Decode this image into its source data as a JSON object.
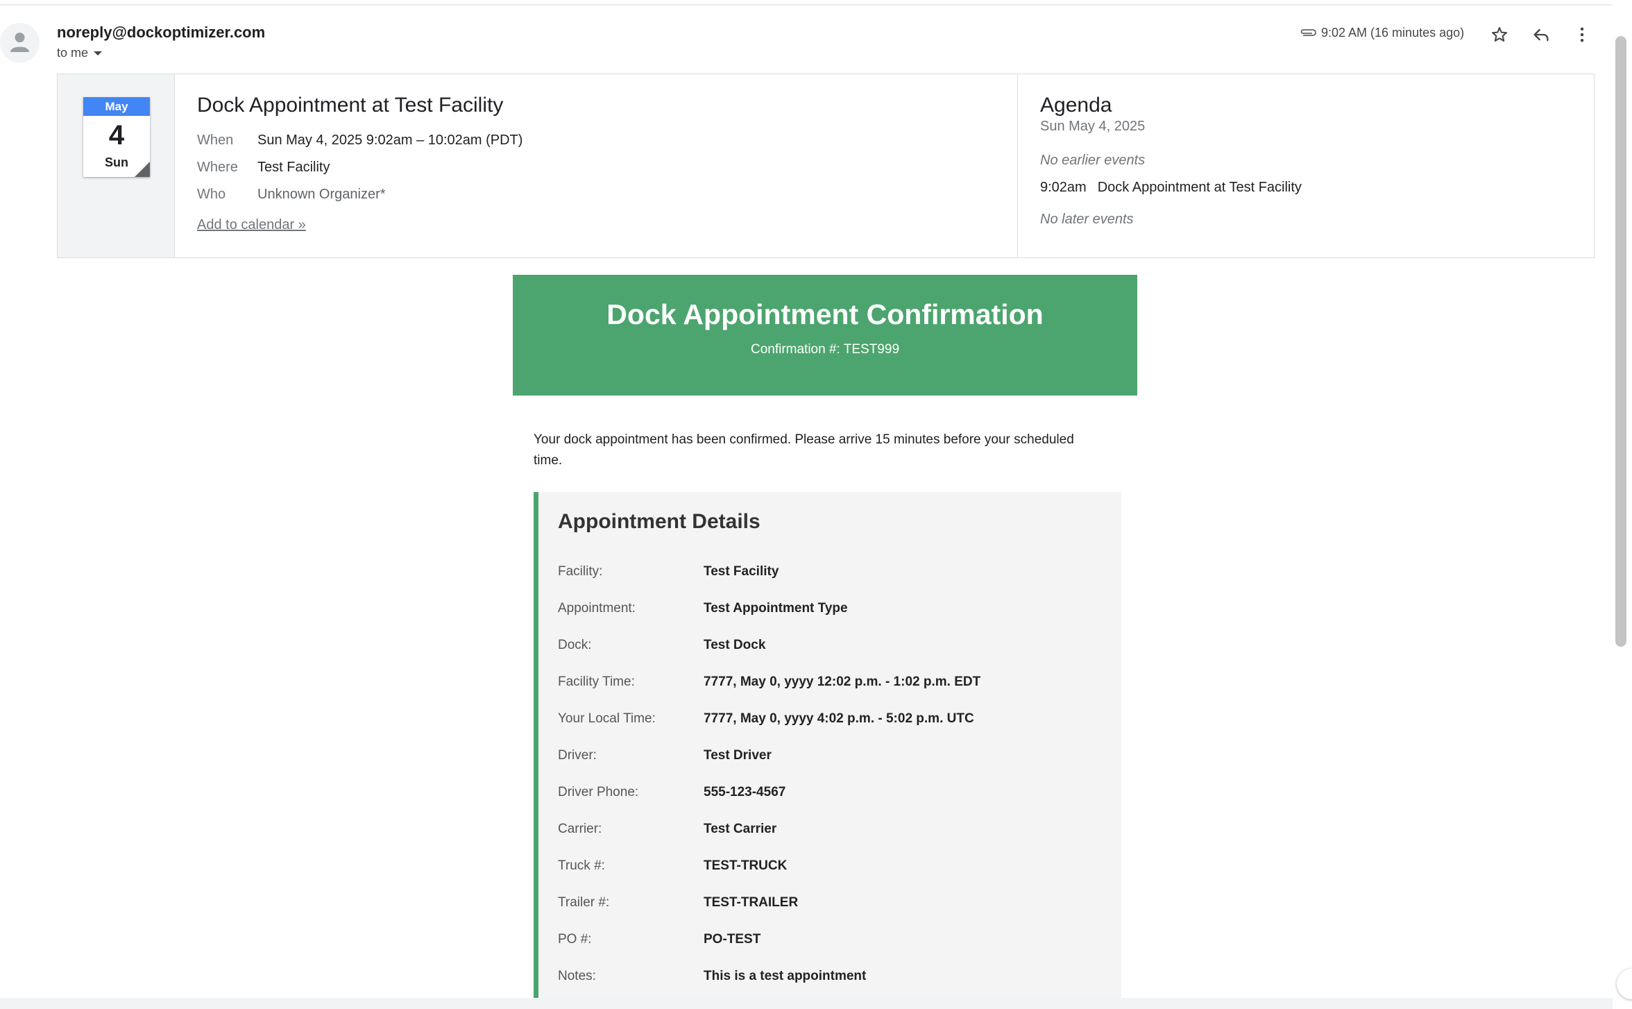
{
  "header": {
    "sender": "noreply@dockoptimizer.com",
    "recipient": "to me",
    "time": "9:02 AM (16 minutes ago)",
    "icons": [
      "attachment-icon",
      "star-icon",
      "reply-icon",
      "more-vert-icon"
    ]
  },
  "calendar": {
    "month": "May",
    "day": "4",
    "weekday": "Sun",
    "title": "Dock Appointment at Test Facility",
    "when_label": "When",
    "when_value": "Sun May 4, 2025 9:02am – 10:02am (PDT)",
    "where_label": "Where",
    "where_value": "Test Facility",
    "who_label": "Who",
    "who_value": "Unknown Organizer*",
    "add_link": "Add to calendar »",
    "agenda_title": "Agenda",
    "agenda_date": "Sun May 4, 2025",
    "no_earlier": "No earlier events",
    "event_time": "9:02am",
    "event_title": "Dock Appointment at Test Facility",
    "no_later": "No later events"
  },
  "email": {
    "banner_title": "Dock Appointment Confirmation",
    "confirmation": "Confirmation #: TEST999",
    "intro": "Your dock appointment has been confirmed. Please arrive 15 minutes before your scheduled time.",
    "details_heading": "Appointment Details",
    "details": [
      {
        "label": "Facility:",
        "value": "Test Facility"
      },
      {
        "label": "Appointment:",
        "value": "Test Appointment Type"
      },
      {
        "label": "Dock:",
        "value": "Test Dock"
      },
      {
        "label": "Facility Time:",
        "value": "7777, May 0, yyyy 12:02 p.m. - 1:02 p.m. EDT"
      },
      {
        "label": "Your Local Time:",
        "value": "7777, May 0, yyyy 4:02 p.m. - 5:02 p.m. UTC"
      },
      {
        "label": "Driver:",
        "value": "Test Driver"
      },
      {
        "label": "Driver Phone:",
        "value": "555-123-4567"
      },
      {
        "label": "Carrier:",
        "value": "Test Carrier"
      },
      {
        "label": "Truck #:",
        "value": "TEST-TRUCK"
      },
      {
        "label": "Trailer #:",
        "value": "TEST-TRAILER"
      },
      {
        "label": "PO #:",
        "value": "PO-TEST"
      },
      {
        "label": "Notes:",
        "value": "This is a test appointment"
      }
    ]
  },
  "colors": {
    "banner_green": "#4ca56e",
    "calendar_blue": "#4285f4",
    "details_bg": "#f4f4f4"
  }
}
